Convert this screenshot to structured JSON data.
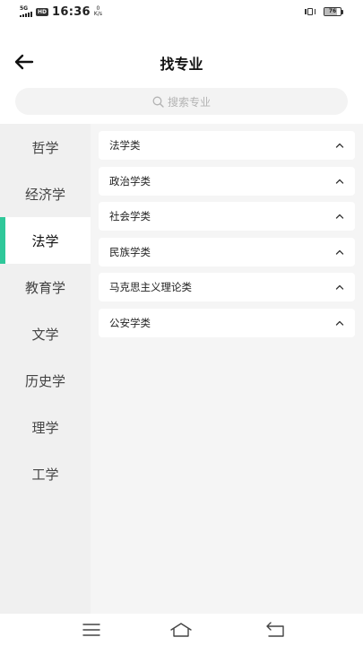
{
  "status_bar": {
    "network": "5G",
    "hd": "HD",
    "time": "16:36",
    "net_speed_value": "0",
    "net_speed_unit": "K/s",
    "battery_level": "76",
    "battery_fraction": 0.76
  },
  "header": {
    "title": "找专业"
  },
  "search": {
    "placeholder": "搜索专业"
  },
  "sidebar": {
    "items": [
      {
        "label": "哲学",
        "active": false
      },
      {
        "label": "经济学",
        "active": false
      },
      {
        "label": "法学",
        "active": true
      },
      {
        "label": "教育学",
        "active": false
      },
      {
        "label": "文学",
        "active": false
      },
      {
        "label": "历史学",
        "active": false
      },
      {
        "label": "理学",
        "active": false
      },
      {
        "label": "工学",
        "active": false
      }
    ]
  },
  "majors": {
    "items": [
      {
        "label": "法学类"
      },
      {
        "label": "政治学类"
      },
      {
        "label": "社会学类"
      },
      {
        "label": "民族学类"
      },
      {
        "label": "马克思主义理论类"
      },
      {
        "label": "公安学类"
      }
    ]
  },
  "colors": {
    "accent": "#2fc89a",
    "sidebar_bg": "#f0f0f0",
    "content_bg": "#f5f5f5"
  },
  "icons": {
    "back": "back-arrow-icon",
    "search": "search-icon",
    "expand": "chevron-up-icon",
    "nav_menu": "menu-icon",
    "nav_home": "home-icon",
    "nav_back": "back-icon"
  }
}
